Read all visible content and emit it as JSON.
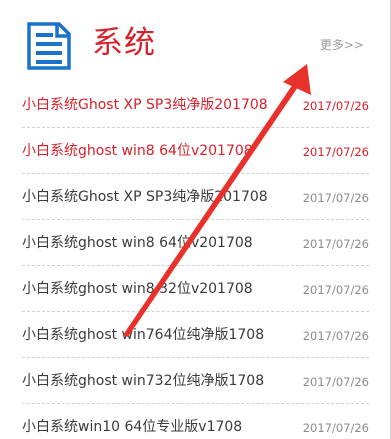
{
  "header": {
    "title": "系统",
    "more_label": "更多>>",
    "icon": "document-icon"
  },
  "articles": [
    {
      "title": "小白系统Ghost XP SP3纯净版201708",
      "date": "2017/07/26",
      "highlighted": true
    },
    {
      "title": "小白系统ghost win8 64位v201708",
      "date": "2017/07/26",
      "highlighted": true
    },
    {
      "title": "小白系统Ghost XP SP3纯净版201708",
      "date": "2017/07/26",
      "highlighted": false
    },
    {
      "title": "小白系统ghost win8 64位v201708",
      "date": "2017/07/26",
      "highlighted": false
    },
    {
      "title": "小白系统ghost win8 32位v201708",
      "date": "2017/07/26",
      "highlighted": false
    },
    {
      "title": "小白系统ghost win764位纯净版1708",
      "date": "2017/07/26",
      "highlighted": false
    },
    {
      "title": "小白系统ghost win732位纯净版1708",
      "date": "2017/07/26",
      "highlighted": false
    },
    {
      "title": "小白系统win10 64位专业版v1708",
      "date": "2017/07/26",
      "highlighted": false
    }
  ],
  "colors": {
    "accent": "#d8202b",
    "icon_blue": "#1a73c9",
    "annotation_arrow": "#e8312a",
    "text": "#3a3a3a",
    "muted": "#8d8d8d"
  },
  "annotation": {
    "type": "arrow",
    "points_to": "more-link"
  }
}
